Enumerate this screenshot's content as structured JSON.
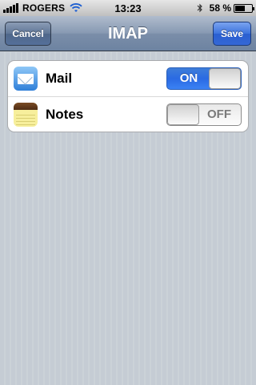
{
  "status_bar": {
    "carrier": "ROGERS",
    "time": "13:23",
    "battery_percent": "58 %",
    "battery_level": 0.58
  },
  "nav": {
    "title": "IMAP",
    "cancel_label": "Cancel",
    "save_label": "Save"
  },
  "settings": [
    {
      "label": "Mail",
      "icon": "mail-icon",
      "toggle_text": "ON",
      "state": "on"
    },
    {
      "label": "Notes",
      "icon": "notes-icon",
      "toggle_text": "OFF",
      "state": "off"
    }
  ],
  "colors": {
    "nav_gradient": "#6d83a1",
    "save_blue": "#2a5fd0",
    "switch_on_blue": "#2a6ae3"
  }
}
